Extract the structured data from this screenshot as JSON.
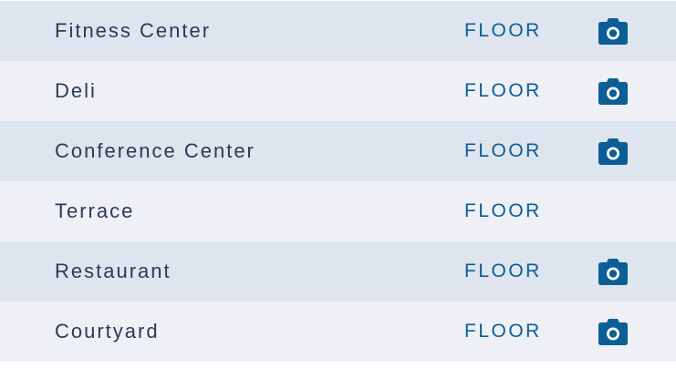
{
  "column_label": "FLOOR",
  "rows": [
    {
      "name": "Fitness Center",
      "has_photo": true
    },
    {
      "name": "Deli",
      "has_photo": true
    },
    {
      "name": "Conference Center",
      "has_photo": true
    },
    {
      "name": "Terrace",
      "has_photo": false
    },
    {
      "name": "Restaurant",
      "has_photo": true
    },
    {
      "name": "Courtyard",
      "has_photo": true
    }
  ],
  "icons": {
    "photo": "camera-icon"
  },
  "colors": {
    "row_odd": "#dfe5ef",
    "row_even": "#eef0f6",
    "name_text": "#2b3a57",
    "floor_text": "#0b5e96",
    "camera": "#0b5e96"
  }
}
